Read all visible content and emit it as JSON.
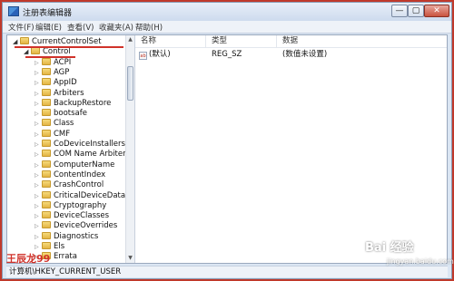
{
  "window": {
    "title": "注册表编辑器",
    "min_glyph": "—",
    "max_glyph": "▢",
    "close_glyph": "✕"
  },
  "menu": [
    "文件(F)",
    "编辑(E)",
    "查看(V)",
    "收藏夹(A)",
    "帮助(H)"
  ],
  "tree": [
    {
      "label": "CurrentControlSet",
      "expanded": true
    },
    {
      "label": "Control",
      "expanded": true
    },
    {
      "label": "ACPI"
    },
    {
      "label": "AGP"
    },
    {
      "label": "AppID"
    },
    {
      "label": "Arbiters"
    },
    {
      "label": "BackupRestore"
    },
    {
      "label": "bootsafe"
    },
    {
      "label": "Class"
    },
    {
      "label": "CMF"
    },
    {
      "label": "CoDeviceInstallers"
    },
    {
      "label": "COM Name Arbiter"
    },
    {
      "label": "ComputerName"
    },
    {
      "label": "ContentIndex"
    },
    {
      "label": "CrashControl"
    },
    {
      "label": "CriticalDeviceDataba"
    },
    {
      "label": "Cryptography"
    },
    {
      "label": "DeviceClasses"
    },
    {
      "label": "DeviceOverrides"
    },
    {
      "label": "Diagnostics"
    },
    {
      "label": "Els"
    },
    {
      "label": "Errata"
    }
  ],
  "list": {
    "columns": [
      "名称",
      "类型",
      "数据"
    ],
    "rows": [
      {
        "name": "(默认)",
        "type": "REG_SZ",
        "data": "(数值未设置)",
        "icon": "string-value-icon"
      }
    ]
  },
  "status": "计算机\\HKEY_CURRENT_USER",
  "watermark": {
    "author": "王辰龙99",
    "brand": "Bai 经验",
    "brand_sub": "jingyan.baidu.com"
  },
  "colors": {
    "annotation_red": "#d0322a",
    "frame_red": "#c0392b"
  }
}
